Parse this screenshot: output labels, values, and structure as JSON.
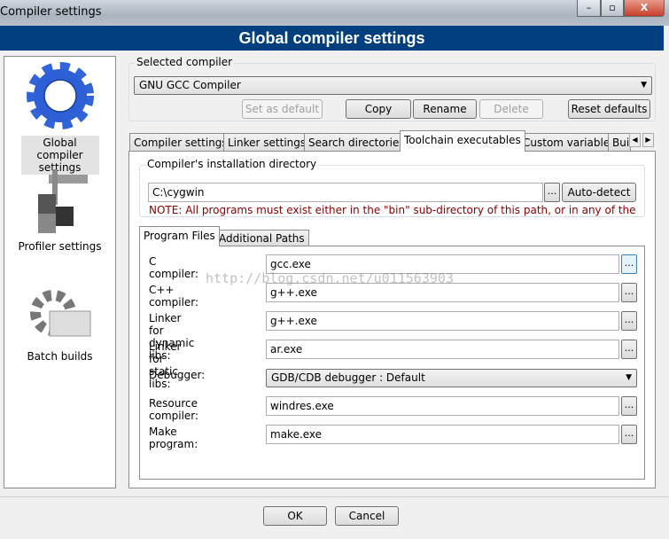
{
  "window": {
    "title": "Compiler settings",
    "minimize_icon": "minimize-icon",
    "maximize_icon": "maximize-icon",
    "close_icon": "close-icon",
    "close_label": "X"
  },
  "header": {
    "title": "Global compiler settings"
  },
  "sidebar": {
    "items": [
      {
        "label": "Global compiler settings",
        "icon": "blue-gear-icon",
        "selected": true
      },
      {
        "label": "Profiler settings",
        "icon": "caliper-icon"
      },
      {
        "label": "Batch builds",
        "icon": "gear-stack-icon"
      }
    ]
  },
  "selected_compiler": {
    "group_label": "Selected compiler",
    "value": "GNU GCC Compiler",
    "buttons": {
      "set_default": "Set as default",
      "copy": "Copy",
      "rename": "Rename",
      "delete": "Delete",
      "reset": "Reset defaults"
    }
  },
  "tabs": [
    {
      "label": "Compiler settings"
    },
    {
      "label": "Linker settings"
    },
    {
      "label": "Search directories"
    },
    {
      "label": "Toolchain executables",
      "active": true
    },
    {
      "label": "Custom variables"
    },
    {
      "label": "Bui"
    }
  ],
  "install_dir": {
    "group_label": "Compiler's installation directory",
    "value": "C:\\cygwin",
    "browse": "...",
    "auto_detect": "Auto-detect",
    "note": "NOTE: All programs must exist either in the \"bin\" sub-directory of this path, or in any of the",
    "note_color": "#8b0000"
  },
  "inner_tabs": [
    {
      "label": "Program Files",
      "active": true
    },
    {
      "label": "Additional Paths"
    }
  ],
  "programs": [
    {
      "label": "C compiler:",
      "value": "gcc.exe"
    },
    {
      "label": "C++ compiler:",
      "value": "g++.exe"
    },
    {
      "label": "Linker for dynamic libs:",
      "value": "g++.exe"
    },
    {
      "label": "Linker for static libs:",
      "value": "ar.exe"
    },
    {
      "label": "Debugger:",
      "value": "GDB/CDB debugger : Default",
      "type": "dropdown"
    },
    {
      "label": "Resource compiler:",
      "value": "windres.exe"
    },
    {
      "label": "Make program:",
      "value": "make.exe"
    }
  ],
  "browse_label": "...",
  "watermark": "http://blog.csdn.net/u011563903",
  "footer": {
    "ok": "OK",
    "cancel": "Cancel"
  },
  "colors": {
    "header_bg": "#013f7f",
    "accent": "#3a6fd8"
  }
}
